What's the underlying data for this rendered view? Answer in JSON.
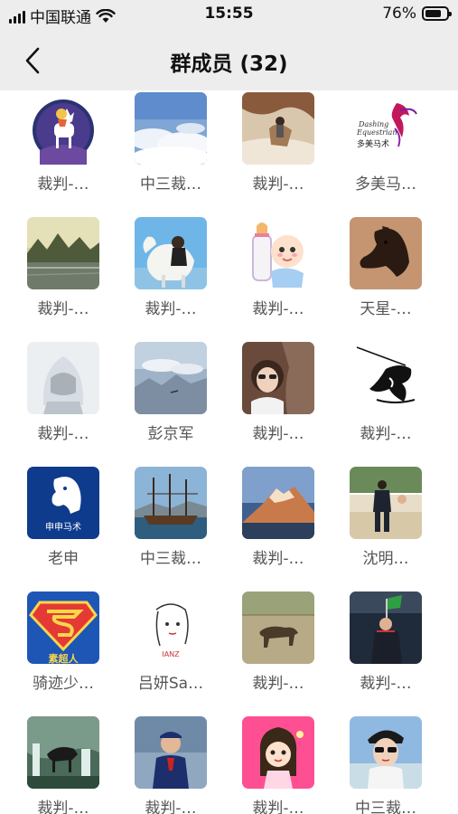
{
  "status_bar": {
    "carrier": "中国联通",
    "time": "15:55",
    "battery": "76%",
    "battery_level": 0.76
  },
  "nav": {
    "title": "群成员 (32)"
  },
  "members": [
    {
      "name": "裁判-…",
      "avatar": "cartoon-deer-rider"
    },
    {
      "name": "中三裁…",
      "avatar": "sky-clouds"
    },
    {
      "name": "裁判-…",
      "avatar": "person-on-rock"
    },
    {
      "name": "多美马…",
      "avatar": "dashing-equestrian-logo",
      "logo_text": "Dashing Equestrian",
      "logo_cn": "多美马术"
    },
    {
      "name": "裁判-…",
      "avatar": "mountain-lake"
    },
    {
      "name": "裁判-…",
      "avatar": "girl-with-white-horse"
    },
    {
      "name": "裁判-…",
      "avatar": "cartoon-baby-bottle"
    },
    {
      "name": "天星-…",
      "avatar": "dark-horse-head"
    },
    {
      "name": "裁判-…",
      "avatar": "hooded-child"
    },
    {
      "name": "彭京军",
      "avatar": "sky-mountains"
    },
    {
      "name": "裁判-…",
      "avatar": "woman-with-horse"
    },
    {
      "name": "裁判-…",
      "avatar": "ink-horse-drawing"
    },
    {
      "name": "老申",
      "avatar": "shenshen-equestrian-logo",
      "logo_cn": "申申马术"
    },
    {
      "name": "中三裁…",
      "avatar": "sailing-ship"
    },
    {
      "name": "裁判-…",
      "avatar": "snow-mountain-peak"
    },
    {
      "name": "沈明…",
      "avatar": "man-in-arena"
    },
    {
      "name": "骑迹少…",
      "avatar": "superman-logo",
      "logo_cn": "素超人"
    },
    {
      "name": "吕妍Sa…",
      "avatar": "sketch-girl"
    },
    {
      "name": "裁判-…",
      "avatar": "horse-in-field"
    },
    {
      "name": "裁判-…",
      "avatar": "rider-with-flag"
    },
    {
      "name": "裁判-…",
      "avatar": "horse-waterfall"
    },
    {
      "name": "裁判-…",
      "avatar": "official-with-cap"
    },
    {
      "name": "裁判-…",
      "avatar": "cartoon-girl-pink"
    },
    {
      "name": "中三裁…",
      "avatar": "woman-sunglasses"
    }
  ]
}
